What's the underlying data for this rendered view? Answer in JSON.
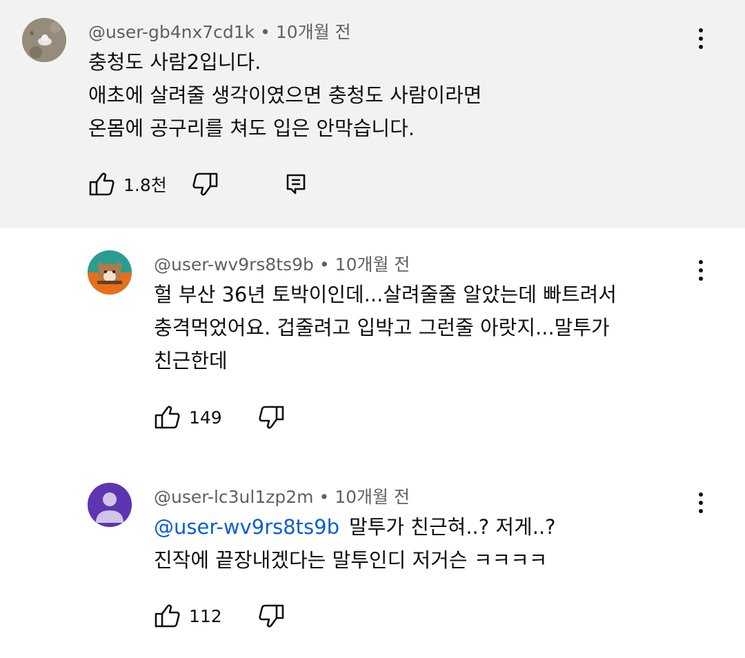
{
  "comments": [
    {
      "author": "@user-gb4nx7cd1k",
      "time": "10개월 전",
      "lines": [
        "충청도 사람2입니다.",
        "애초에 살려줄 생각이였으면 충청도 사람이라면",
        "온몸에 공구리를 쳐도 입은 안막습니다."
      ],
      "likes": "1.8천",
      "icons": [
        "like-icon",
        "dislike-icon",
        "reply-icon",
        "more-vertical-icon"
      ]
    },
    {
      "author": "@user-wv9rs8ts9b",
      "time": "10개월 전",
      "lines": [
        "헐  부산 36년 토박이인데...살려줄줄 알았는데 빠트려서",
        "충격먹었어요. 겁줄려고 입박고 그런줄 아랏지...말투가",
        "친근한데"
      ],
      "likes": "149",
      "icons": [
        "like-icon",
        "dislike-icon",
        "more-vertical-icon"
      ]
    },
    {
      "author": "@user-lc3ul1zp2m",
      "time": "10개월 전",
      "mention": "@user-wv9rs8ts9b",
      "lines": [
        "말투가 친근혀..? 저게..?",
        "진작에 끝장내겠다는 말투인디 저거슨 ㅋㅋㅋㅋ"
      ],
      "likes": "112",
      "icons": [
        "like-icon",
        "dislike-icon",
        "more-vertical-icon"
      ]
    }
  ],
  "colors": {
    "highlight_bg": "#f2f2f2",
    "meta_text": "#606060",
    "mention": "#065fd4",
    "avatar_purple": "#5e35b1"
  }
}
